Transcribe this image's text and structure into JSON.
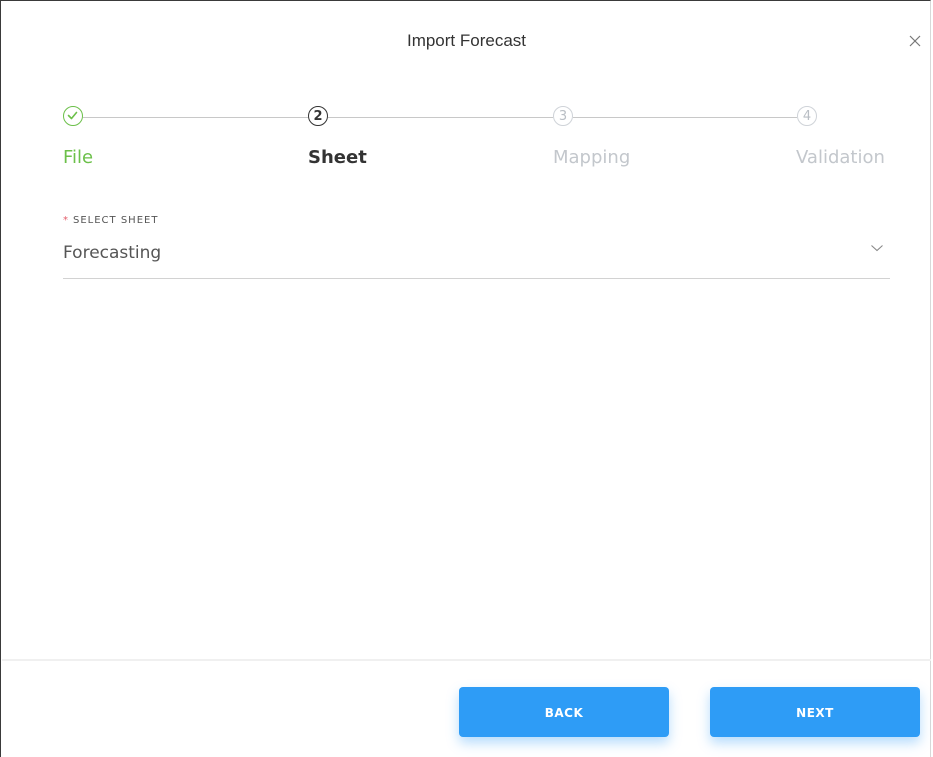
{
  "dialog": {
    "title": "Import Forecast"
  },
  "stepper": {
    "steps": [
      {
        "number": "",
        "label": "File",
        "state": "completed",
        "icon": "check-icon"
      },
      {
        "number": "2",
        "label": "Sheet",
        "state": "active"
      },
      {
        "number": "3",
        "label": "Mapping",
        "state": "pending"
      },
      {
        "number": "4",
        "label": "Validation",
        "state": "pending"
      }
    ]
  },
  "select_sheet": {
    "label": "SELECT SHEET",
    "required_marker": "*",
    "value": "Forecasting"
  },
  "footer": {
    "back_label": "BACK",
    "next_label": "NEXT"
  },
  "colors": {
    "accent": "#2e9cf6",
    "success": "#6cc04a",
    "required": "#e35d6a"
  }
}
